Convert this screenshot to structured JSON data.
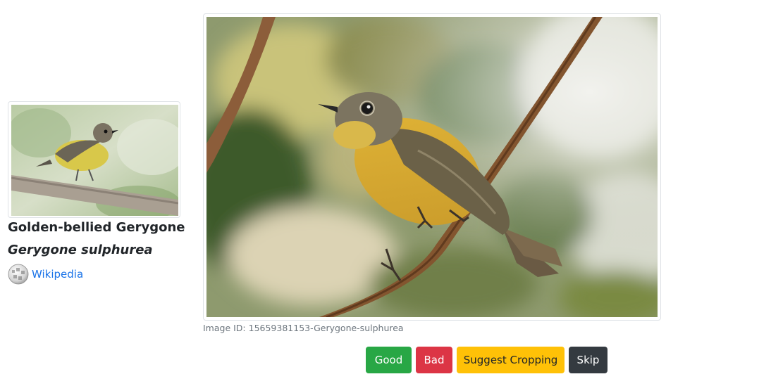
{
  "species": {
    "common_name": "Golden-bellied Gerygone",
    "scientific_name": "Gerygone sulphurea",
    "wiki_link_label": "Wikipedia",
    "wiki_icon": "wikipedia-globe-icon"
  },
  "main_image": {
    "caption": "Image ID: 15659381153-Gerygone-sulphurea"
  },
  "actions": {
    "good_label": "Good",
    "bad_label": "Bad",
    "crop_label": "Suggest Cropping",
    "skip_label": "Skip"
  },
  "colors": {
    "good": "#28a745",
    "bad": "#dc3545",
    "crop": "#ffc107",
    "skip": "#343a40",
    "link": "#1a73e8"
  }
}
